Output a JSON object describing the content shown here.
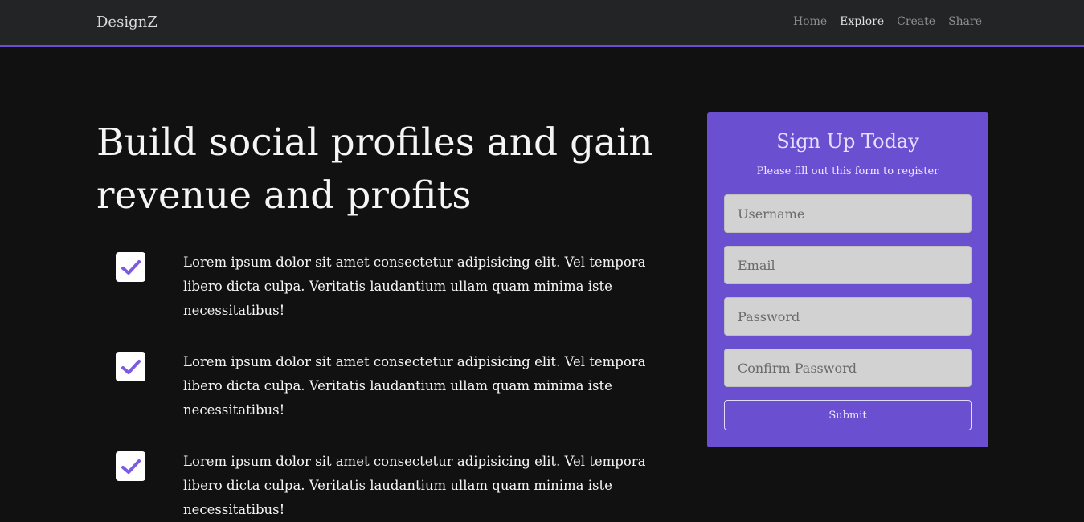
{
  "navbar": {
    "brand": "DesignZ",
    "links": [
      {
        "label": "Home"
      },
      {
        "label": "Explore"
      },
      {
        "label": "Create"
      },
      {
        "label": "Share"
      }
    ],
    "active_link": "Explore"
  },
  "hero": {
    "title": "Build social profiles and gain revenue and profits"
  },
  "features": [
    {
      "text": "Lorem ipsum dolor sit amet consectetur adipisicing elit. Vel tempora libero dicta culpa. Veritatis laudantium ullam quam minima iste necessitatibus!"
    },
    {
      "text": "Lorem ipsum dolor sit amet consectetur adipisicing elit. Vel tempora libero dicta culpa. Veritatis laudantium ullam quam minima iste necessitatibus!"
    },
    {
      "text": "Lorem ipsum dolor sit amet consectetur adipisicing elit. Vel tempora libero dicta culpa. Veritatis laudantium ullam quam minima iste necessitatibus!"
    }
  ],
  "signup": {
    "title": "Sign Up Today",
    "subtitle": "Please fill out this form to register",
    "fields": {
      "username": {
        "placeholder": "Username",
        "value": ""
      },
      "email": {
        "placeholder": "Email",
        "value": ""
      },
      "password": {
        "placeholder": "Password",
        "value": ""
      },
      "confirm_password": {
        "placeholder": "Confirm Password",
        "value": ""
      }
    },
    "submit_label": "Submit"
  },
  "colors": {
    "accent": "#6a4fd0",
    "background": "#111112",
    "navbar": "#232425",
    "check_icon": "#7b5be0"
  },
  "icons": {
    "feature_check": "check-icon"
  }
}
